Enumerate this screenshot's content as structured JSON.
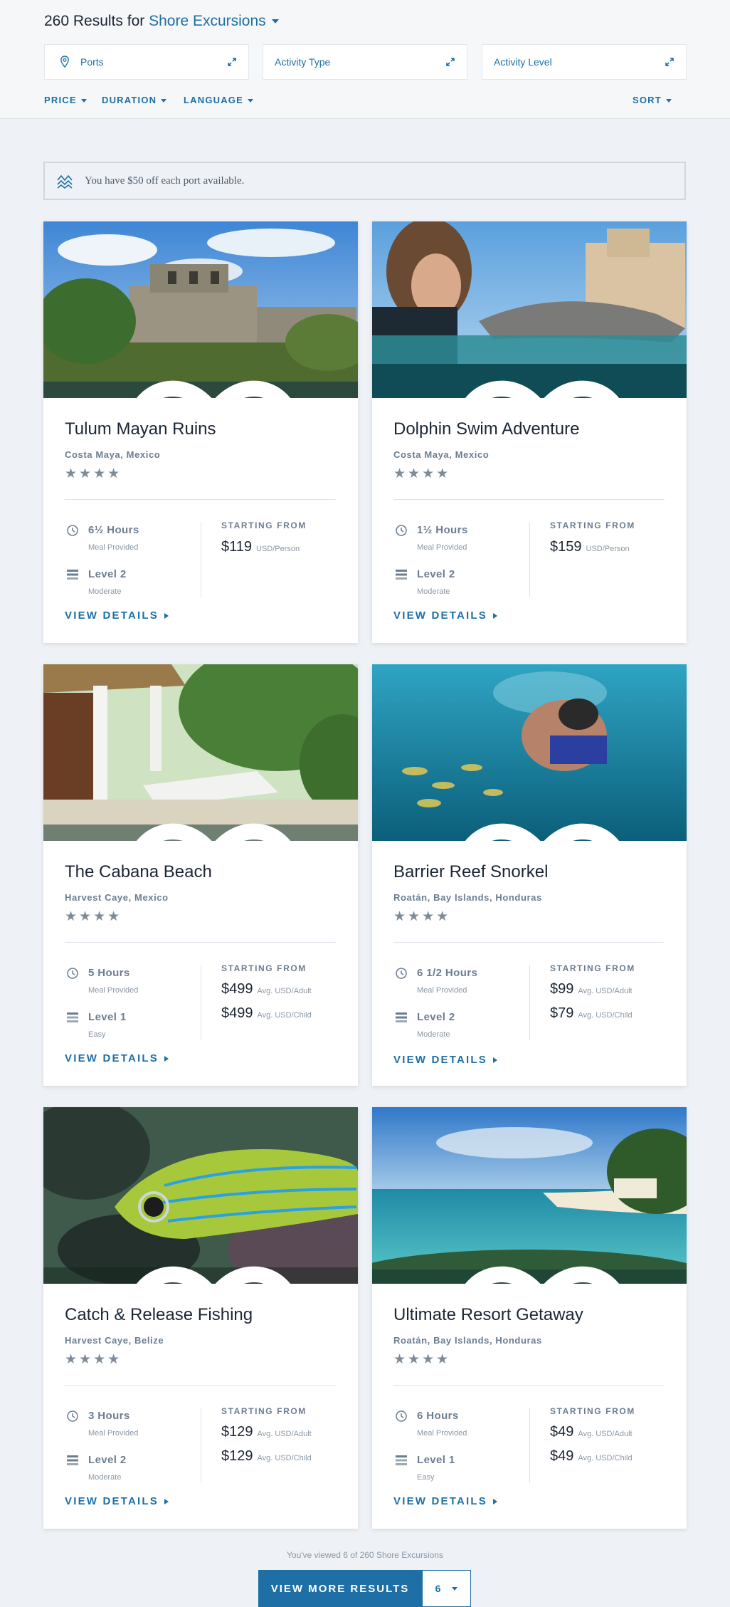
{
  "header": {
    "count_text": "260 Results for",
    "category": "Shore Excursions",
    "filters": [
      {
        "label": "Ports",
        "icon": "map-pin-icon"
      },
      {
        "label": "Activity Type",
        "icon": "expand-icon"
      },
      {
        "label": "Activity Level",
        "icon": "expand-icon"
      }
    ],
    "sub_filters": [
      "PRICE",
      "DURATION",
      "LANGUAGE"
    ],
    "sort": "SORT"
  },
  "promo": {
    "text": "You have $50 off each port available.",
    "icon": "waves-icon"
  },
  "colors": {
    "accent": "#1d6fa5",
    "text": "#1b2634",
    "muted": "#6b7d90",
    "background": "#eef1f5"
  },
  "cards": [
    {
      "title": "Tulum Mayan Ruins",
      "location": "Costa Maya, Mexico",
      "rating": "★★★★",
      "duration": "6½ Hours",
      "duration_note": "Meal Provided",
      "level": "Level 2",
      "level_note": "Moderate",
      "starting_label": "STARTING FROM",
      "prices": [
        {
          "amount": "$119",
          "unit": "USD/Person"
        }
      ],
      "details": "VIEW DETAILS"
    },
    {
      "title": "Dolphin Swim Adventure",
      "location": "Costa Maya, Mexico",
      "rating": "★★★★",
      "duration": "1½ Hours",
      "duration_note": "Meal Provided",
      "level": "Level 2",
      "level_note": "Moderate",
      "starting_label": "STARTING FROM",
      "prices": [
        {
          "amount": "$159",
          "unit": "USD/Person"
        }
      ],
      "details": "VIEW DETAILS"
    },
    {
      "title": "The Cabana Beach",
      "location": "Harvest Caye, Mexico",
      "rating": "★★★★",
      "duration": "5 Hours",
      "duration_note": "Meal Provided",
      "level": "Level 1",
      "level_note": "Easy",
      "starting_label": "STARTING FROM",
      "prices": [
        {
          "amount": "$499",
          "unit": "Avg. USD/Adult"
        },
        {
          "amount": "$499",
          "unit": "Avg. USD/Child"
        }
      ],
      "details": "VIEW DETAILS"
    },
    {
      "title": "Barrier Reef Snorkel",
      "location": "Roatán, Bay Islands, Honduras",
      "rating": "★★★★",
      "duration": "6 1/2 Hours",
      "duration_note": "Meal Provided",
      "level": "Level 2",
      "level_note": "Moderate",
      "starting_label": "STARTING FROM",
      "prices": [
        {
          "amount": "$99",
          "unit": "Avg. USD/Adult"
        },
        {
          "amount": "$79",
          "unit": "Avg. USD/Child"
        }
      ],
      "details": "VIEW DETAILS"
    },
    {
      "title": "Catch & Release Fishing",
      "location": "Harvest Caye, Belize",
      "rating": "★★★★",
      "duration": "3 Hours",
      "duration_note": "Meal Provided",
      "level": "Level 2",
      "level_note": "Moderate",
      "starting_label": "STARTING FROM",
      "prices": [
        {
          "amount": "$129",
          "unit": "Avg. USD/Adult"
        },
        {
          "amount": "$129",
          "unit": "Avg. USD/Child"
        }
      ],
      "details": "VIEW DETAILS"
    },
    {
      "title": "Ultimate Resort Getaway",
      "location": "Roatán, Bay Islands, Honduras",
      "rating": "★★★★",
      "duration": "6 Hours",
      "duration_note": "Meal Provided",
      "level": "Level 1",
      "level_note": "Easy",
      "starting_label": "STARTING FROM",
      "prices": [
        {
          "amount": "$49",
          "unit": "Avg. USD/Adult"
        },
        {
          "amount": "$49",
          "unit": "Avg. USD/Child"
        }
      ],
      "details": "VIEW DETAILS"
    }
  ],
  "footer": {
    "viewed_text": "You've viewed 6 of 260 Shore Excursions",
    "more_label": "VIEW MORE RESULTS",
    "page_size": "6"
  }
}
